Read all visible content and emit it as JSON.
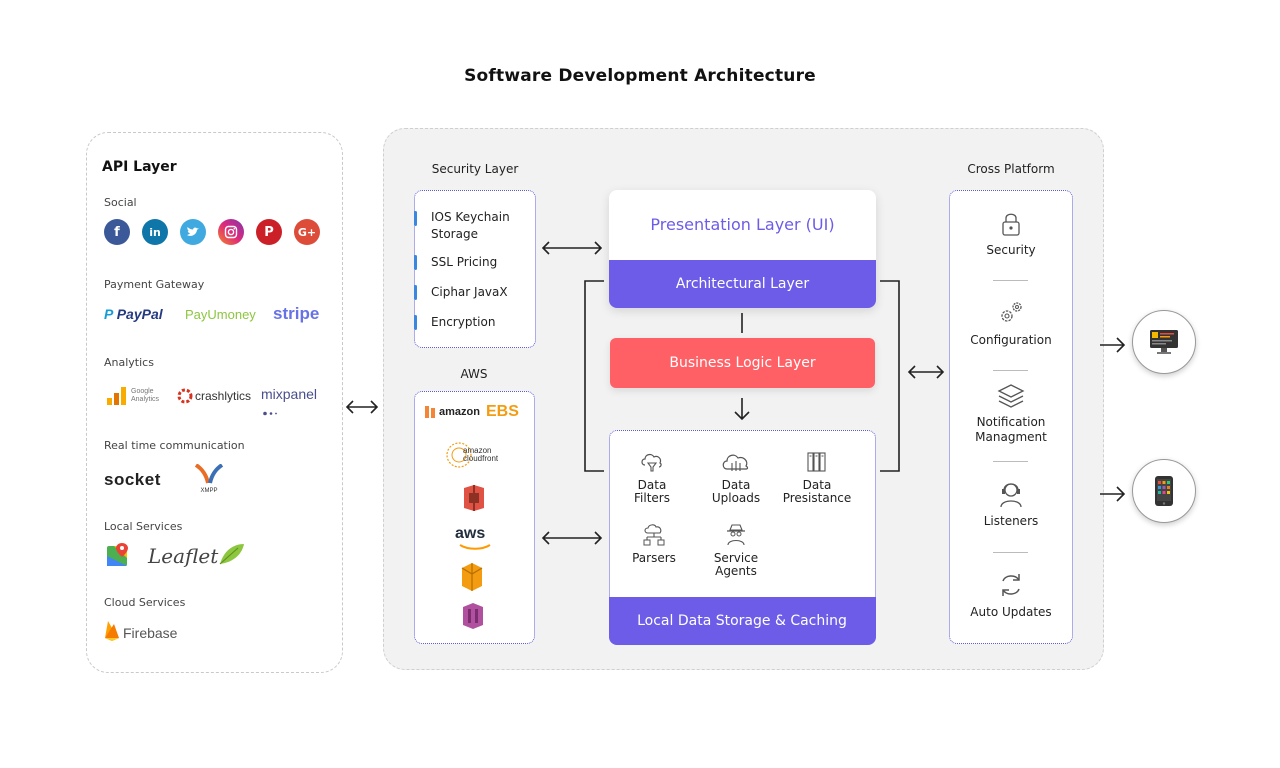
{
  "title": "Software Development Architecture",
  "api_layer": {
    "title": "API Layer",
    "social_label": "Social",
    "social_icons": [
      "facebook-icon",
      "linkedin-icon",
      "twitter-icon",
      "instagram-icon",
      "pinterest-icon",
      "google-plus-icon"
    ],
    "payment_label": "Payment Gateway",
    "payment_logos": [
      "PayPal",
      "PayUmoney",
      "stripe"
    ],
    "analytics_label": "Analytics",
    "analytics_logos": [
      "Google Analytics",
      "crashlytics",
      "mixpanel"
    ],
    "realtime_label": "Real time communication",
    "realtime_logos": [
      "socket",
      "XMPP"
    ],
    "local_label": "Local Services",
    "local_logos": [
      "Leaflet"
    ],
    "cloud_label": "Cloud Services",
    "cloud_logos": [
      "Firebase"
    ]
  },
  "security_layer": {
    "heading": "Security Layer",
    "items": [
      "IOS Keychain Storage",
      "SSL Pricing",
      "Ciphar JavaX",
      "Encryption"
    ]
  },
  "aws": {
    "heading": "AWS",
    "logos": [
      "amazon",
      "EBS",
      "amazon cloudfront",
      "aws"
    ]
  },
  "presentation_layer": "Presentation Layer (UI)",
  "architectural_layer": "Architectural Layer",
  "business_logic_layer": "Business Logic Layer",
  "data_storage": {
    "items": [
      "Data Filters",
      "Data Uploads",
      "Data Presistance",
      "Parsers",
      "Service Agents"
    ],
    "band_label": "Local Data Storage & Caching"
  },
  "cross_platform": {
    "heading": "Cross Platform",
    "items": [
      "Security",
      "Configuration",
      "Notification Managment",
      "Listeners",
      "Auto Updates"
    ]
  },
  "devices": [
    "desktop-monitor-icon",
    "mobile-phone-icon"
  ],
  "colors": {
    "accent_purple": "#6c5ce7",
    "business_red": "#ff6065",
    "security_bar_blue": "#3a87e0"
  }
}
